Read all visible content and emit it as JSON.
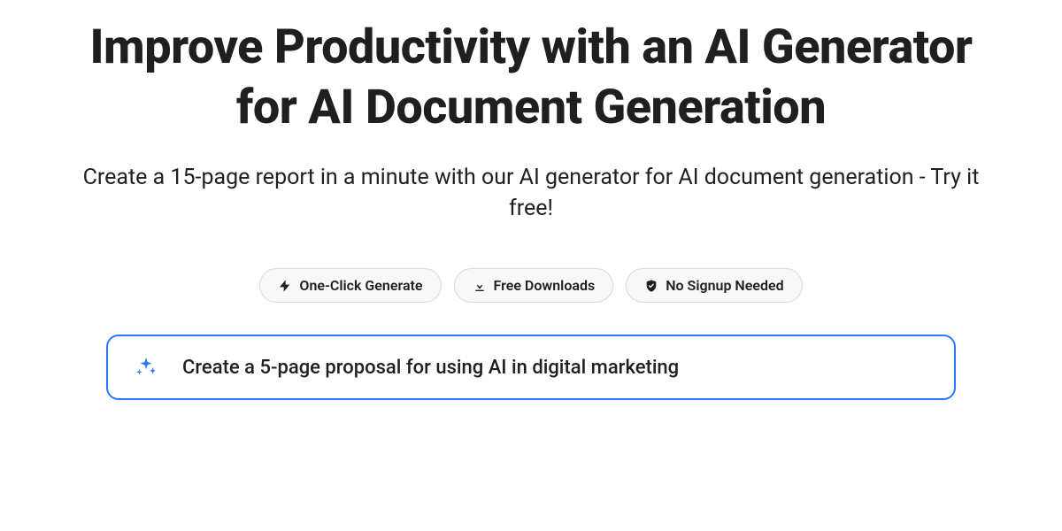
{
  "hero": {
    "headline": "Improve Productivity with an AI Generator for AI Document Generation",
    "subheadline": "Create a 15-page report in a minute with our AI generator for AI document generation - Try it free!"
  },
  "badges": [
    {
      "icon": "bolt-icon",
      "label": "One-Click Generate"
    },
    {
      "icon": "download-icon",
      "label": "Free Downloads"
    },
    {
      "icon": "shield-check-icon",
      "label": "No Signup Needed"
    }
  ],
  "prompt": {
    "value": "Create a 5-page proposal for using AI in digital marketing"
  }
}
